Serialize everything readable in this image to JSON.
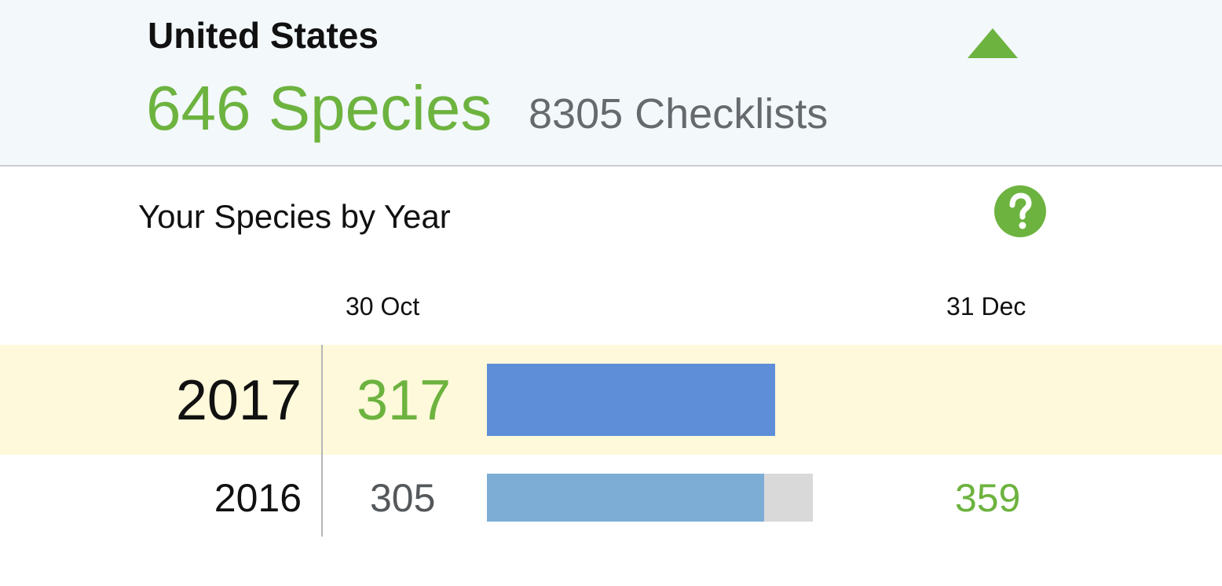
{
  "header": {
    "region": "United States",
    "species": "646 Species",
    "checklists": "8305 Checklists",
    "collapse_icon": "triangle-up-icon",
    "accent_color": "#6db33f"
  },
  "chart": {
    "title": "Your Species by Year",
    "help_icon": "question-mark-icon",
    "date_start": "30 Oct",
    "date_end": "31 Dec"
  },
  "chart_data": {
    "type": "bar",
    "categories": [
      "2017",
      "2016"
    ],
    "series": [
      {
        "values": [
          317,
          305
        ]
      },
      {
        "values": [
          null,
          359
        ]
      }
    ],
    "labels": {
      "2017": {
        "year": "2017",
        "count": "317",
        "total": ""
      },
      "2016": {
        "year": "2016",
        "count": "305",
        "total": "359"
      }
    },
    "xlim": [
      0,
      405
    ],
    "colors": {
      "current": "#5e8ed8",
      "previous": "#7dadd5",
      "remaining": "#d9d9d9",
      "highlight_row": "#fdf9da"
    }
  }
}
